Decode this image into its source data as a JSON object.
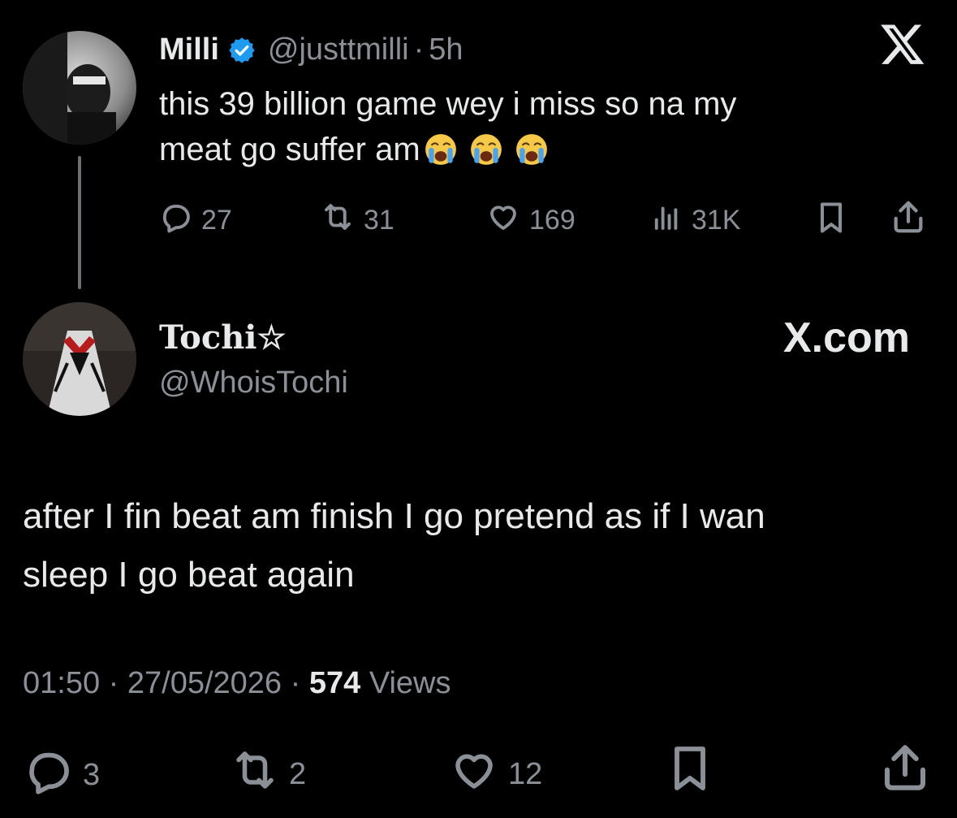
{
  "top_tweet": {
    "name": "Milli",
    "handle": "@justtmilli",
    "time": "5h",
    "text_line1": "this 39 billion game wey i miss so na my",
    "text_line2": "meat go suffer am",
    "emoji_count": 3,
    "replies": "27",
    "reposts": "31",
    "likes": "169",
    "views": "31K"
  },
  "reply_tweet": {
    "name": "Tochi☆",
    "handle": "@WhoisTochi",
    "text_line1": "after I fin beat am finish I go pretend as if I wan",
    "text_line2": "sleep I go beat again",
    "time": "01:50",
    "date": "27/05/2026",
    "views_count": "574",
    "views_label": "Views",
    "replies": "3",
    "reposts": "2",
    "likes": "12"
  },
  "brand": {
    "x_logo": "X",
    "x_com": "X.com"
  },
  "colors": {
    "background": "#000000",
    "text": "#e7e9ea",
    "muted": "#8b9096",
    "verified": "#1d9bf0"
  }
}
